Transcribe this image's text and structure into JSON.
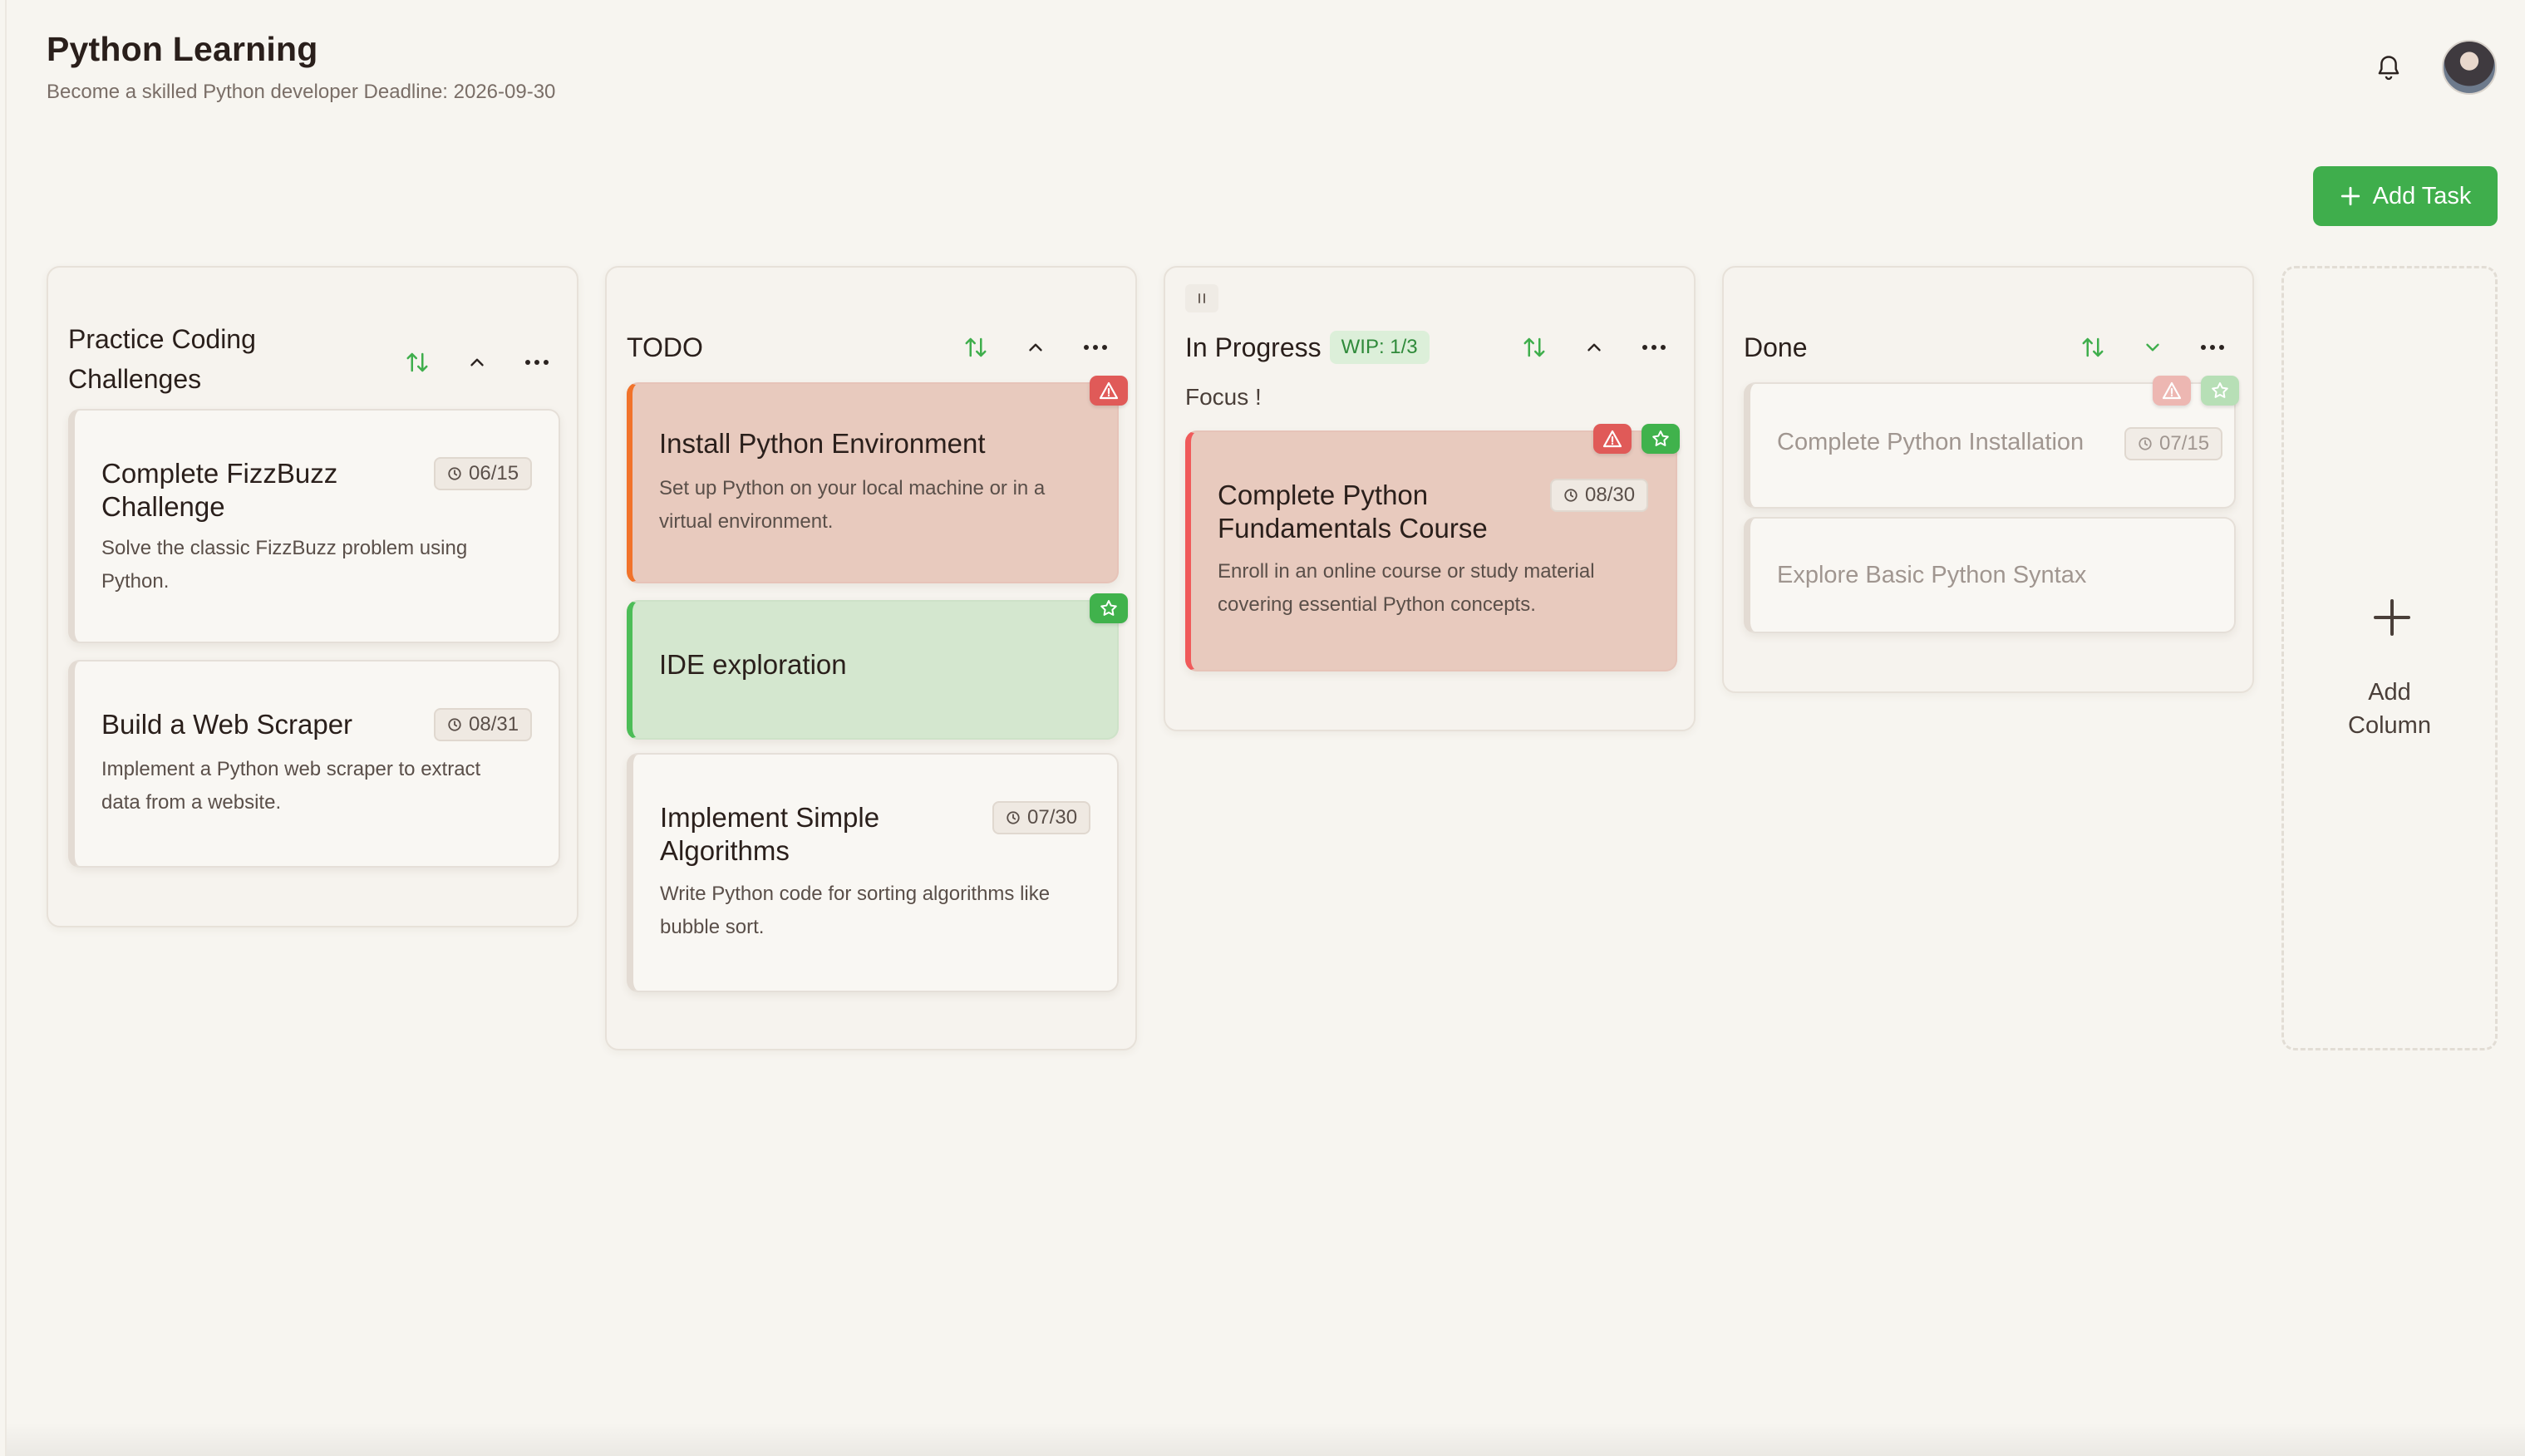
{
  "header": {
    "title": "Python Learning",
    "subtitle": "Become a skilled Python developer Deadline: 2026-09-30"
  },
  "actions": {
    "add_task_label": "Add Task"
  },
  "columns": [
    {
      "title_line1": "Practice Coding",
      "title_line2": "Challenges",
      "cards": [
        {
          "title_line1": "Complete FizzBuzz",
          "title_line2": "Challenge",
          "date": "06/15",
          "desc_line1": "Solve the classic FizzBuzz problem using",
          "desc_line2": "Python."
        },
        {
          "title_line1": "Build a Web Scraper",
          "date": "08/31",
          "desc_line1": "Implement a Python web scraper to extract",
          "desc_line2": "data from a website."
        }
      ]
    },
    {
      "title": "TODO",
      "cards": [
        {
          "title": "Install Python Environment",
          "desc_line1": "Set up Python on your local machine or in a",
          "desc_line2": "virtual environment.",
          "badges": [
            "alert"
          ]
        },
        {
          "title": "IDE exploration",
          "badges": [
            "star"
          ]
        },
        {
          "title_line1": "Implement Simple",
          "title_line2": "Algorithms",
          "date": "07/30",
          "desc_line1": "Write Python code for sorting algorithms like",
          "desc_line2": "bubble sort."
        }
      ]
    },
    {
      "title": "In Progress",
      "wip": "WIP: 1/3",
      "note": "Focus !",
      "cards": [
        {
          "title_line1": "Complete Python",
          "title_line2": "Fundamentals Course",
          "date": "08/30",
          "desc_line1": "Enroll in an online course or study material",
          "desc_line2": "covering essential Python concepts.",
          "badges": [
            "alert",
            "star"
          ]
        }
      ]
    },
    {
      "title": "Done",
      "cards": [
        {
          "title": "Complete Python Installation",
          "date": "07/15",
          "badges": [
            "alert",
            "star"
          ]
        },
        {
          "title": "Explore Basic Python Syntax"
        }
      ]
    }
  ],
  "add_column": {
    "label_line1": "Add",
    "label_line2": "Column"
  },
  "colors": {
    "accent_green": "#3fae4c",
    "alert_red": "#e05a58",
    "priority_orange": "#f1722a",
    "background": "#f7f5f0"
  },
  "icons": [
    "bell-icon",
    "avatar",
    "plus-icon",
    "sort-icon",
    "chevron-up-icon",
    "chevron-down-icon",
    "more-icon",
    "clock-icon",
    "alert-icon",
    "star-icon",
    "drag-handle-icon"
  ]
}
